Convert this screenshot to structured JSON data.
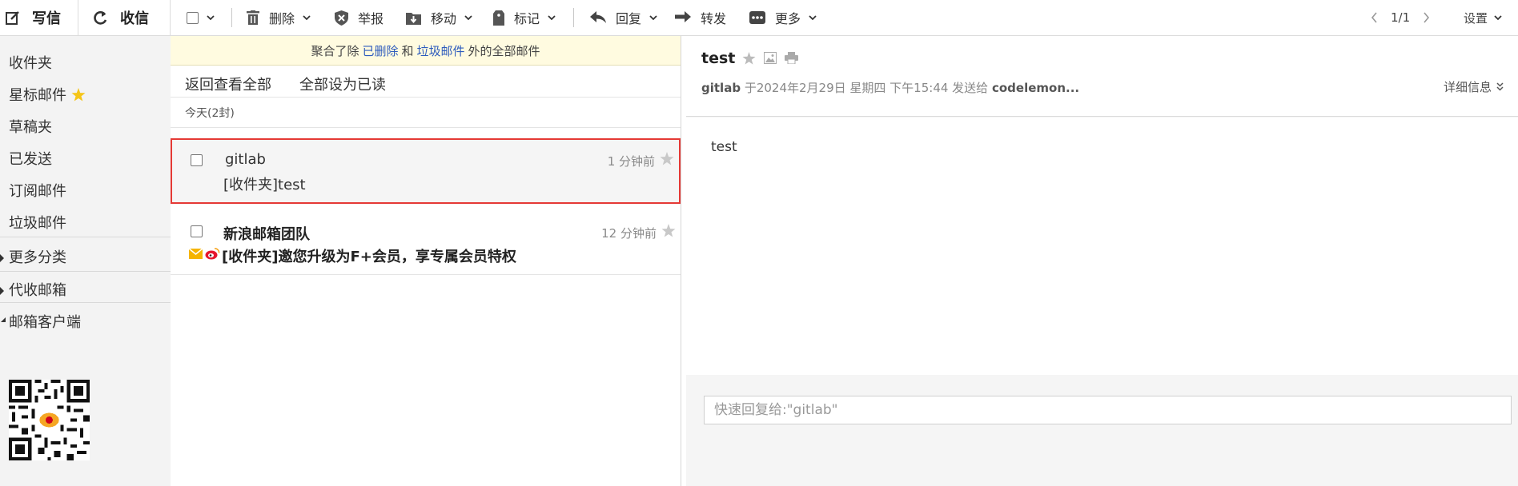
{
  "toolbar": {
    "compose": "写信",
    "receive": "收信",
    "delete": "删除",
    "report": "举报",
    "move": "移动",
    "mark": "标记",
    "reply": "回复",
    "forward": "转发",
    "more": "更多",
    "pager": "1/1",
    "settings": "设置"
  },
  "sidebar": {
    "items": [
      "收件夹",
      "星标邮件",
      "草稿夹",
      "已发送",
      "订阅邮件",
      "垃圾邮件"
    ],
    "more_categories": "更多分类",
    "proxy_mailbox": "代收邮箱",
    "mail_client": "邮箱客户端"
  },
  "list": {
    "notice_prefix": "聚合了除",
    "notice_deleted": "已删除",
    "notice_and": "和",
    "notice_spam": "垃圾邮件",
    "notice_suffix": "外的全部邮件",
    "back_all": "返回查看全部",
    "mark_all_read": "全部设为已读",
    "day_section": "今天(2封)",
    "mails": [
      {
        "from": "gitlab",
        "subject": "[收件夹]test",
        "time": "1 分钟前",
        "unread": false,
        "selected": true
      },
      {
        "from": "新浪邮箱团队",
        "subject": "[收件夹]邀您升级为F+会员，享专属会员特权",
        "time": "12 分钟前",
        "unread": true,
        "selected": false
      }
    ]
  },
  "reader": {
    "subject": "test",
    "sender": "gitlab",
    "sent_text": "于2024年2月29日 星期四 下午15:44 发送给",
    "recipient": "codelemon...",
    "details": "详细信息",
    "body": "test",
    "quick_reply_placeholder": "快速回复给:\"gitlab\""
  },
  "colors": {
    "selected_border": "#e53935",
    "star_yellow": "#f5c518",
    "notice_bg": "#fffbe0",
    "link_blue": "#2d5bbd"
  }
}
